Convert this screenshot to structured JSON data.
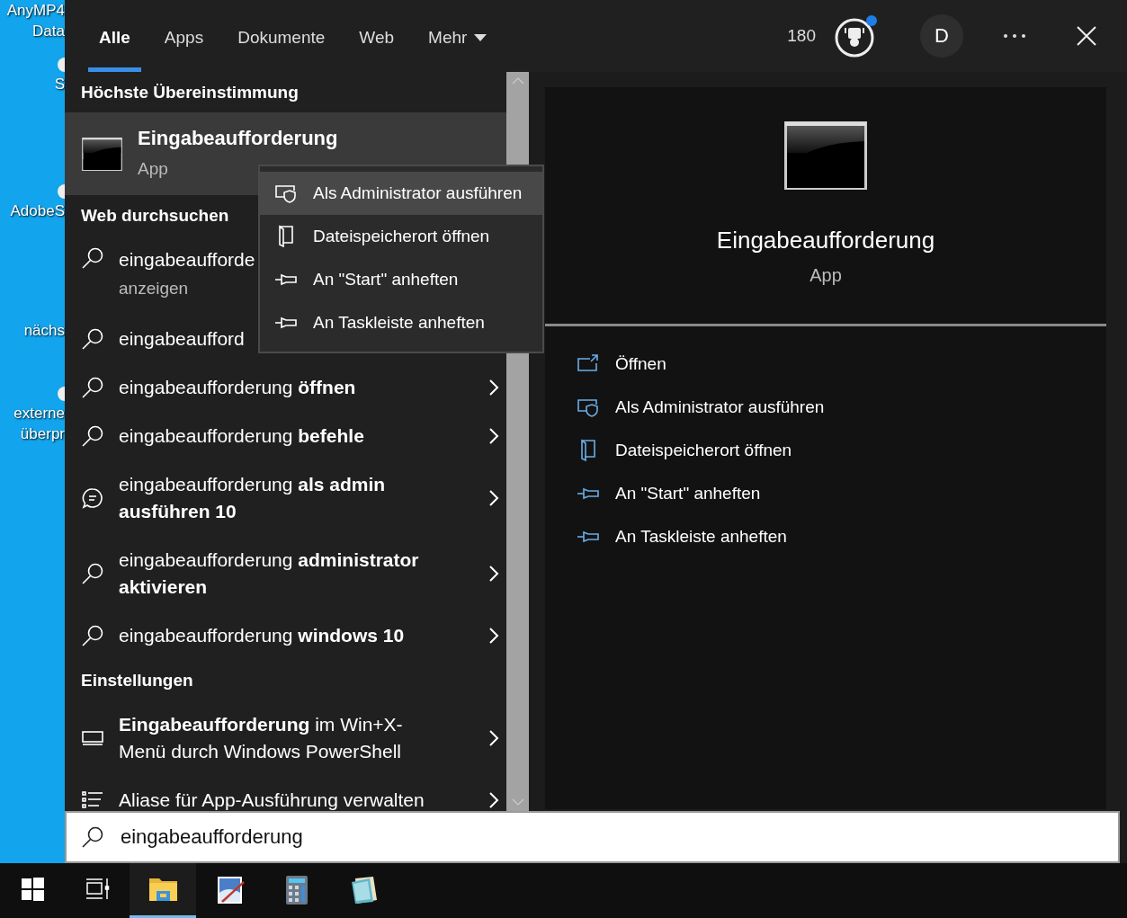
{
  "desktop_icons": [
    {
      "lines": [
        "AnyMP4",
        "Data"
      ],
      "icon": false
    },
    {
      "lines": [
        "S"
      ],
      "icon": true
    },
    {
      "lines": [
        "AdobeS"
      ],
      "icon": true
    },
    {
      "lines": [
        "nächs"
      ],
      "icon": false
    },
    {
      "lines": [
        "externe",
        "überpr"
      ],
      "icon": true
    }
  ],
  "tabs": [
    {
      "label": "Alle",
      "selected": true,
      "dropdown": false
    },
    {
      "label": "Apps",
      "selected": false,
      "dropdown": false
    },
    {
      "label": "Dokumente",
      "selected": false,
      "dropdown": false
    },
    {
      "label": "Web",
      "selected": false,
      "dropdown": false
    },
    {
      "label": "Mehr",
      "selected": false,
      "dropdown": true
    }
  ],
  "points": "180",
  "reward_badge": true,
  "avatar": "D",
  "sections": [
    {
      "heading": "Höchste Übereinstimmung",
      "items": [
        {
          "kind": "app",
          "text": "Eingabeaufforderung",
          "subtext": "App",
          "selected": true,
          "chevron": false
        }
      ]
    },
    {
      "heading": "Web durchsuchen",
      "items": [
        {
          "kind": "search",
          "text": "eingabeaufforde",
          "subtext": "anzeigen",
          "selected": false
        },
        {
          "kind": "search",
          "text": "eingabeaufford",
          "selected": false
        },
        {
          "kind": "search",
          "text": "eingabeaufforderung **öffnen**",
          "selected": false,
          "chevron": true
        },
        {
          "kind": "search",
          "text": "eingabeaufforderung **befehle**",
          "selected": false,
          "chevron": true
        },
        {
          "kind": "chat",
          "text": "eingabeaufforderung **als admin ausführen 10**",
          "selected": false,
          "chevron": true
        },
        {
          "kind": "search",
          "text": "eingabeaufforderung **administrator aktivieren**",
          "selected": false,
          "chevron": true
        },
        {
          "kind": "search",
          "text": "eingabeaufforderung **windows 10**",
          "selected": false,
          "chevron": true
        }
      ]
    },
    {
      "heading": "Einstellungen",
      "items": [
        {
          "kind": "display",
          "text": "**Eingabeaufforderung** im Win+X-Menü durch Windows PowerShell",
          "selected": false,
          "chevron": true
        },
        {
          "kind": "list",
          "text": "Aliase für App-Ausführung verwalten",
          "selected": false,
          "chevron": true
        }
      ]
    }
  ],
  "context_menu": [
    {
      "kind": "shield",
      "label": "Als Administrator ausführen",
      "selected": true
    },
    {
      "kind": "folder",
      "label": "Dateispeicherort öffnen",
      "selected": false
    },
    {
      "kind": "pin",
      "label": "An \"Start\" anheften",
      "selected": false
    },
    {
      "kind": "pin",
      "label": "An Taskleiste anheften",
      "selected": false
    }
  ],
  "preview": {
    "title": "Eingabeaufforderung",
    "subtitle": "App",
    "actions": [
      {
        "kind": "open",
        "label": "Öffnen"
      },
      {
        "kind": "shield",
        "label": "Als Administrator ausführen"
      },
      {
        "kind": "folder",
        "label": "Dateispeicherort öffnen"
      },
      {
        "kind": "pin",
        "label": "An \"Start\" anheften"
      },
      {
        "kind": "pin",
        "label": "An Taskleiste anheften"
      }
    ]
  },
  "search": {
    "value": "eingabeaufforderung"
  },
  "taskbar": [
    {
      "kind": "start",
      "selected": false
    },
    {
      "kind": "taskview",
      "selected": false
    },
    {
      "kind": "explorer",
      "selected": true
    },
    {
      "kind": "paint",
      "selected": false
    },
    {
      "kind": "calculator",
      "selected": false
    },
    {
      "kind": "notepad",
      "selected": false
    }
  ]
}
